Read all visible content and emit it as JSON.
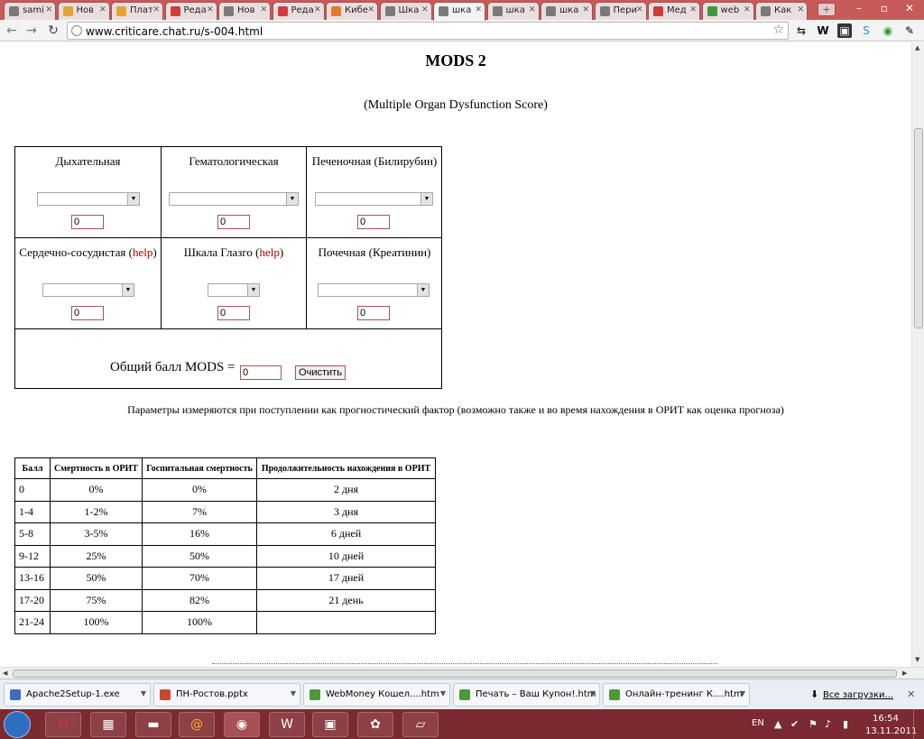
{
  "browser": {
    "tabs": [
      {
        "label": "sami",
        "color": "#7a7a7a"
      },
      {
        "label": "Нов",
        "color": "#e7a230"
      },
      {
        "label": "Плат",
        "color": "#e7a230"
      },
      {
        "label": "Реда",
        "color": "#d33a3a"
      },
      {
        "label": "Нов",
        "color": "#7a7a7a"
      },
      {
        "label": "Реда",
        "color": "#d33a3a"
      },
      {
        "label": "Кибе",
        "color": "#e7792b"
      },
      {
        "label": "Шка",
        "color": "#7a7a7a"
      },
      {
        "label": "шка",
        "color": "#7a7a7a",
        "active": true
      },
      {
        "label": "шка",
        "color": "#7a7a7a"
      },
      {
        "label": "шка",
        "color": "#7a7a7a"
      },
      {
        "label": "Пери",
        "color": "#7a7a7a"
      },
      {
        "label": "Мед",
        "color": "#d33a3a"
      },
      {
        "label": "web",
        "color": "#3a9a3a"
      },
      {
        "label": "Как",
        "color": "#7a7a7a"
      }
    ],
    "url": "www.criticare.chat.ru/s-004.html"
  },
  "page": {
    "title": "MODS 2",
    "subtitle": "(Multiple Organ Dysfunction Score)",
    "calc": {
      "respiratory": {
        "label": "Дыхательная",
        "value": "0"
      },
      "hematologic": {
        "label": "Гематологическая",
        "value": "0"
      },
      "hepatic": {
        "label": "Печеночная (Билирубин)",
        "value": "0"
      },
      "cardiovascular": {
        "label": "Сердечно-сосудистая (",
        "help": "help",
        "close": ")",
        "value": "0"
      },
      "glasgow": {
        "label": "Шкала Глазго (",
        "help": "help",
        "close": ")",
        "value": "0"
      },
      "renal": {
        "label": "Почечная (Креатинин)",
        "value": "0"
      },
      "total_label": "Общий балл MODS =",
      "total_value": "0",
      "clear_label": "Очистить"
    },
    "note": "Параметры измеряются при поступлении как прогностический фактор (возможно также и во время нахождения в ОРИТ как оценка прогноза)",
    "table": {
      "headers": [
        "Балл",
        "Смертность в ОРИТ",
        "Госпитальная смертность",
        "Продолжительность нахождения в ОРИТ"
      ],
      "rows": [
        [
          "0",
          "0%",
          "0%",
          "2 дня"
        ],
        [
          "1-4",
          "1-2%",
          "7%",
          "3 дня"
        ],
        [
          "5-8",
          "3-5%",
          "16%",
          "6 дней"
        ],
        [
          "9-12",
          "25%",
          "50%",
          "10 дней"
        ],
        [
          "13-16",
          "50%",
          "70%",
          "17 дней"
        ],
        [
          "17-20",
          "75%",
          "82%",
          "21 день"
        ],
        [
          "21-24",
          "100%",
          "100%",
          ""
        ]
      ]
    }
  },
  "downloads": {
    "items": [
      {
        "label": "Apache2Setup-1.exe",
        "color": "#3a6fc0"
      },
      {
        "label": "ПН-Ростов.pptx",
        "color": "#c9482f"
      },
      {
        "label": "WebMoney Кошел....htm",
        "color": "#4a9a3a"
      },
      {
        "label": "Печать – Ваш Купон!.htm",
        "color": "#4a9a3a"
      },
      {
        "label": "Онлайн-тренинг К....htm",
        "color": "#4a9a3a"
      }
    ],
    "all_label": "Все загрузки..."
  },
  "taskbar": {
    "lang": "EN",
    "time": "16:54",
    "date": "13.11.2011"
  }
}
